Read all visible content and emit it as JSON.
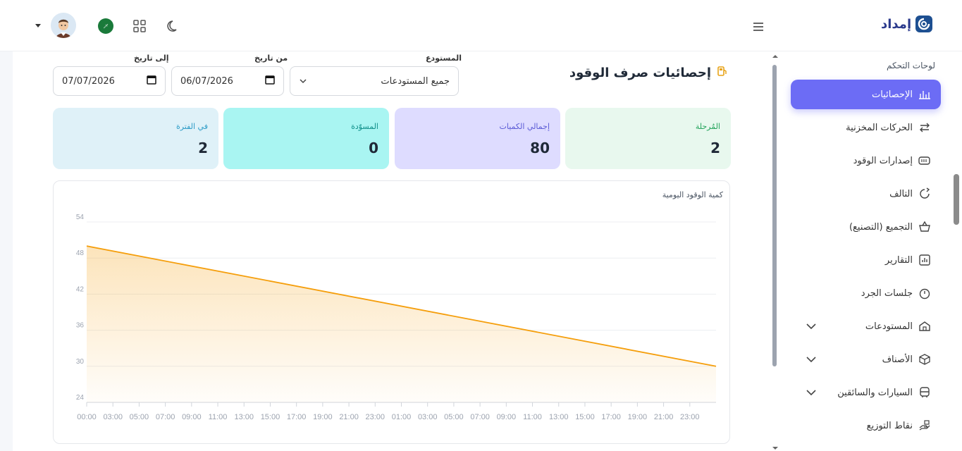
{
  "brand": {
    "name": "إمداد"
  },
  "sidebar": {
    "section_title": "لوحات التحكم",
    "items": [
      {
        "label": "الإحصائيات",
        "icon": "bar-chart-icon",
        "active": true,
        "expandable": false
      },
      {
        "label": "الحركات المخزنية",
        "icon": "transfer-arrows-icon",
        "active": false,
        "expandable": false
      },
      {
        "label": "إصدارات الوقود",
        "icon": "fuel-gauge-icon",
        "active": false,
        "expandable": false
      },
      {
        "label": "التالف",
        "icon": "refresh-icon",
        "active": false,
        "expandable": false
      },
      {
        "label": "التجميع (التصنيع)",
        "icon": "basket-icon",
        "active": false,
        "expandable": false
      },
      {
        "label": "التقارير",
        "icon": "report-icon",
        "active": false,
        "expandable": false
      },
      {
        "label": "جلسات الجرد",
        "icon": "timer-icon",
        "active": false,
        "expandable": false
      },
      {
        "label": "المستودعات",
        "icon": "warehouse-icon",
        "active": false,
        "expandable": true
      },
      {
        "label": "الأصناف",
        "icon": "cube-icon",
        "active": false,
        "expandable": true
      },
      {
        "label": "السيارات والسائقين",
        "icon": "bus-icon",
        "active": false,
        "expandable": true
      },
      {
        "label": "نقاط التوزيع",
        "icon": "handover-icon",
        "active": false,
        "expandable": false
      }
    ]
  },
  "page": {
    "title": "إحصائيات صرف الوقود",
    "title_icon": "fuel-pump-icon",
    "filters": {
      "warehouse_label": "المستودع",
      "warehouse_value": "جميع المستودعات",
      "from_label": "من تاريخ",
      "from_value": "06/07/2026",
      "to_label": "إلى تاريخ",
      "to_value": "07/07/2026"
    },
    "cards": [
      {
        "label": "المُرحلة",
        "value": "2",
        "bg": "#e8f8ee",
        "fg": "#22a35a"
      },
      {
        "label": "إجمالي الكميات",
        "value": "80",
        "bg": "#dedcff",
        "fg": "#5b5bd6"
      },
      {
        "label": "المسوّدة",
        "value": "0",
        "bg": "#a9f5f2",
        "fg": "#0f8f8a"
      },
      {
        "label": "في الفترة",
        "value": "2",
        "bg": "#dff1f8",
        "fg": "#2d9cc7"
      }
    ]
  },
  "chart_data": {
    "type": "area",
    "title": "كمية الوقود اليومية",
    "x": [
      "00:00",
      "03:00",
      "05:00",
      "07:00",
      "09:00",
      "11:00",
      "13:00",
      "15:00",
      "17:00",
      "19:00",
      "21:00",
      "23:00",
      "01:00",
      "03:00",
      "05:00",
      "07:00",
      "09:00",
      "11:00",
      "13:00",
      "15:00",
      "17:00",
      "19:00",
      "21:00",
      "23:00"
    ],
    "series": [
      {
        "points": [
          {
            "x": 0,
            "y": 50
          },
          {
            "x": 24,
            "y": 30
          }
        ],
        "color": "#f59e0b"
      }
    ],
    "yticks": [
      54,
      48,
      42,
      36,
      30,
      24
    ],
    "ylim": [
      24,
      54
    ],
    "grid": true
  }
}
